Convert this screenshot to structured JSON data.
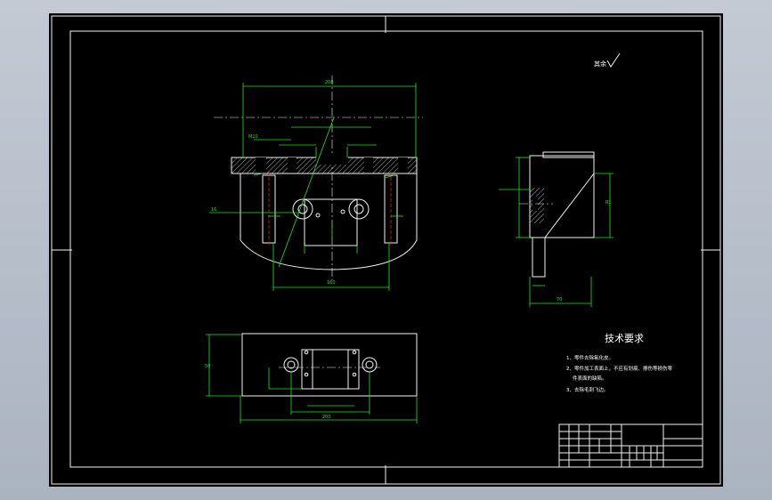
{
  "drawing": {
    "tech_requirements": {
      "title": "技术要求",
      "items": [
        "1、零件去除氧化皮。",
        "2、零件加工表面上，不应有划痕、擦伤等损伤零",
        "件表面的缺陷。",
        "3、去除毛刺飞边。"
      ]
    },
    "roughness_note": "其余",
    "colors": {
      "background": "#000000",
      "outline": "#f2f2f2",
      "dimension": "#1ee61e",
      "hidden_axis": "#e01e1e",
      "screen": "#b4bcc8"
    }
  }
}
